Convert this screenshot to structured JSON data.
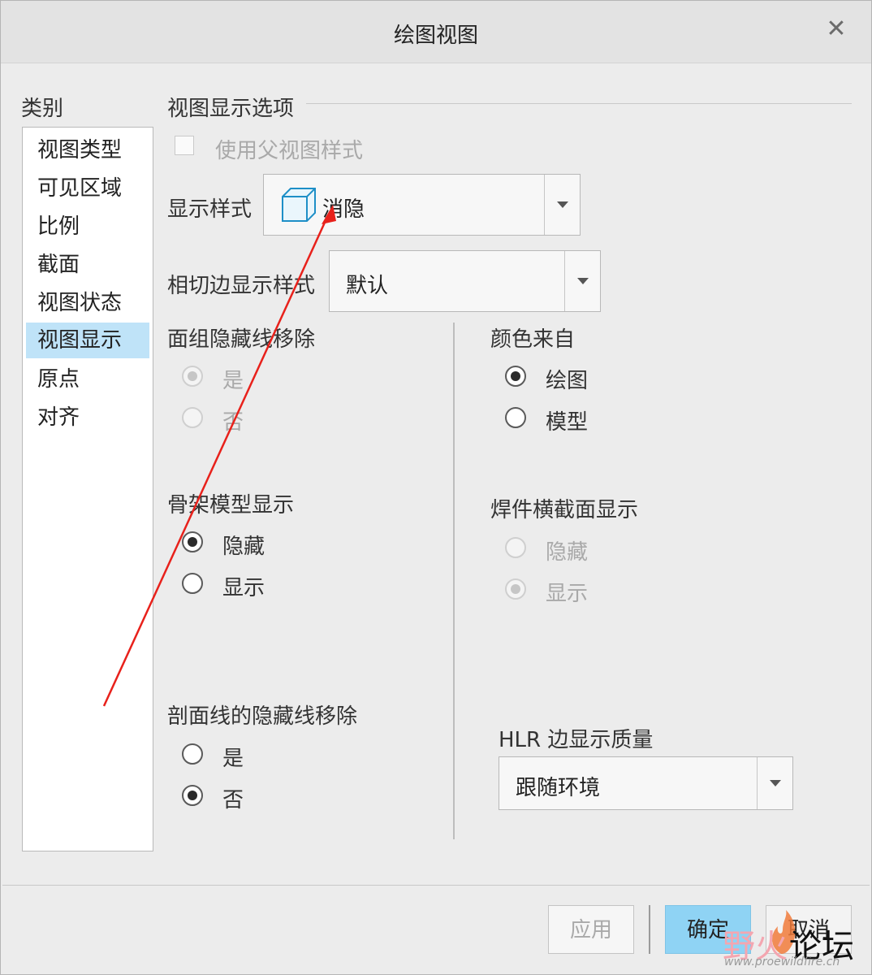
{
  "window": {
    "title": "绘图视图",
    "close_icon": "close-icon"
  },
  "category": {
    "header": "类别",
    "items": [
      "视图类型",
      "可见区域",
      "比例",
      "截面",
      "视图状态",
      "视图显示",
      "原点",
      "对齐"
    ],
    "selected": "视图显示"
  },
  "display_options": {
    "group_title": "视图显示选项",
    "use_parent_style": {
      "label": "使用父视图样式",
      "checked": false,
      "enabled": false
    },
    "display_style": {
      "label": "显示样式",
      "value": "消隐",
      "icon": "hidden-line-cube-icon"
    },
    "tangent_edge_style": {
      "label": "相切边显示样式",
      "value": "默认"
    }
  },
  "quilt_hidden_line_removal": {
    "label": "面组隐藏线移除",
    "options": [
      "是",
      "否"
    ],
    "selected": "是",
    "enabled": false
  },
  "color_from": {
    "label": "颜色来自",
    "options": [
      "绘图",
      "模型"
    ],
    "selected": "绘图",
    "enabled": true
  },
  "skeleton_model_display": {
    "label": "骨架模型显示",
    "options": [
      "隐藏",
      "显示"
    ],
    "selected": "隐藏",
    "enabled": true
  },
  "weld_xsec_display": {
    "label": "焊件横截面显示",
    "options": [
      "隐藏",
      "显示"
    ],
    "selected": "显示",
    "enabled": false
  },
  "hatch_hidden_line_removal": {
    "label": "剖面线的隐藏线移除",
    "options": [
      "是",
      "否"
    ],
    "selected": "否",
    "enabled": true
  },
  "hlr_edge_quality": {
    "label": "HLR 边显示质量",
    "value": "跟随环境"
  },
  "buttons": {
    "apply": "应用",
    "ok": "确定",
    "cancel": "取消"
  },
  "watermark": {
    "text_a": "野火",
    "text_b": "论坛",
    "url": "www.proewildfire.cn"
  },
  "colors": {
    "selection": "#bfe3f8",
    "primary_button": "#8fd3f4",
    "annotation_arrow": "#e8211b",
    "cube_icon": "#1e8fc7"
  }
}
